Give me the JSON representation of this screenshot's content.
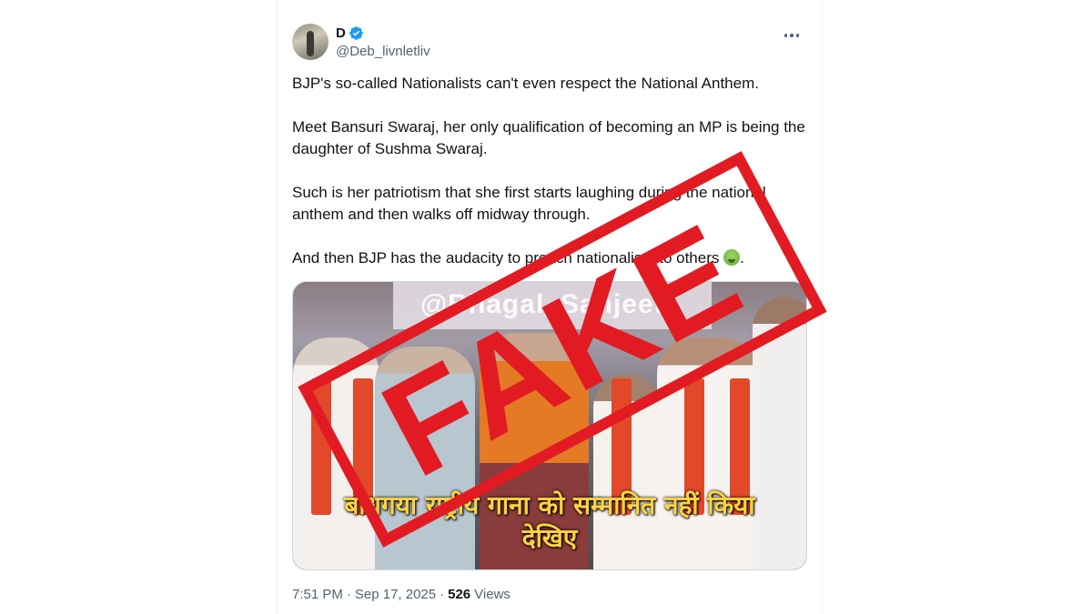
{
  "author": {
    "display_name": "D",
    "handle": "@Deb_livnletliv",
    "verified": true
  },
  "tweet": {
    "paragraphs": [
      "BJP's so-called Nationalists can't even respect the National Anthem.",
      "Meet Bansuri Swaraj, her only qualification of becoming an MP is being the daughter of Sushma Swaraj.",
      "Such is her patriotism that she first starts laughing during the national anthem and then walks off midway through."
    ],
    "last_paragraph_text": "And then BJP has the audacity to preach nationalism to others",
    "last_paragraph_emoji": "nauseated-face-emoji",
    "last_paragraph_end": "."
  },
  "media": {
    "watermark": "@Bhagal_Sanjeet",
    "caption_line1": "बोधगया राष्ट्रीय गाना को सम्मानित नहीं किया",
    "caption_line2": "देखिए"
  },
  "overlay": {
    "stamp_text": "FAKE",
    "stamp_color": "#e21b23"
  },
  "meta": {
    "time": "7:51 PM",
    "separator": "·",
    "date": "Sep 17, 2025",
    "views_count": "526",
    "views_label": "Views"
  },
  "colors": {
    "verified_blue": "#1d9bf0",
    "secondary_text": "#536471",
    "primary_text": "#0f1419"
  }
}
